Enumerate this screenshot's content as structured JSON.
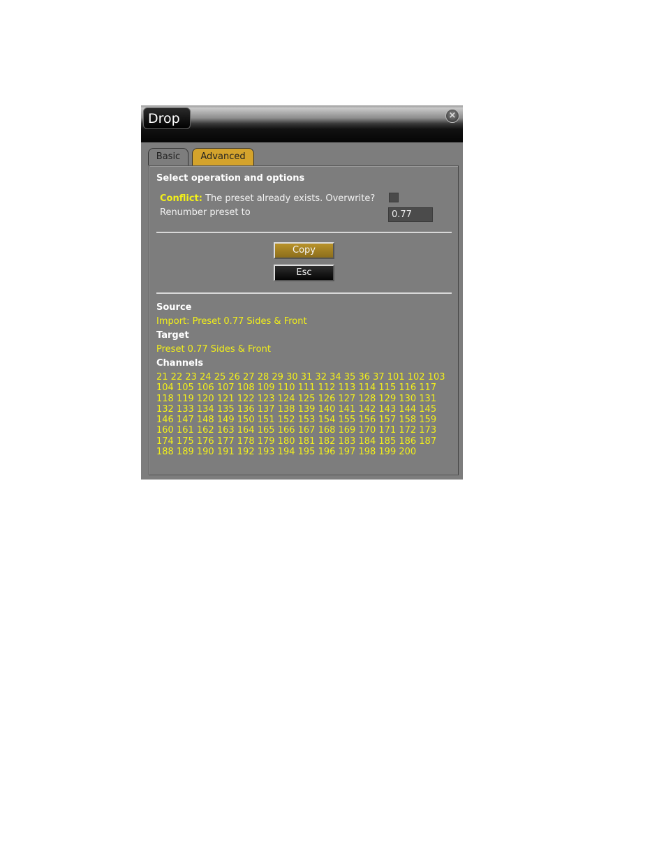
{
  "window": {
    "title": "Drop",
    "close_icon": "close-circle-x-icon"
  },
  "tabs": [
    {
      "label": "Basic",
      "active": false
    },
    {
      "label": "Advanced",
      "active": true
    }
  ],
  "options": {
    "heading": "Select operation and options",
    "conflict_label": "Conflict:",
    "conflict_text": "The preset already exists. Overwrite?",
    "overwrite_checked": false,
    "renumber_label": "Renumber preset to",
    "renumber_value": "0.77"
  },
  "buttons": {
    "copy": "Copy",
    "esc": "Esc"
  },
  "info": {
    "source_label": "Source",
    "source_value": "Import: Preset 0.77 Sides & Front",
    "target_label": "Target",
    "target_value": "Preset 0.77 Sides & Front",
    "channels_label": "Channels",
    "channels": "21 22 23 24 25 26 27 28 29 30 31 32 34 35 36 37 101 102 103 104 105 106 107 108 109 110 111 112 113 114 115 116 117 118 119 120 121 122 123 124 125 126 127 128 129 130 131 132 133 134 135 136 137 138 139 140 141 142 143 144 145 146 147 148 149 150 151 152 153 154 155 156 157 158 159 160 161 162 163 164 165 166 167 168 169 170 171 172 173 174 175 176 177 178 179 180 181 182 183 184 185 186 187 188 189 190 191 192 193 194 195 196 197 198 199 200"
  },
  "colors": {
    "accent_tab": "#d4a32c",
    "highlight_text": "#f2ef1a",
    "panel_bg": "#7d7d7d"
  }
}
